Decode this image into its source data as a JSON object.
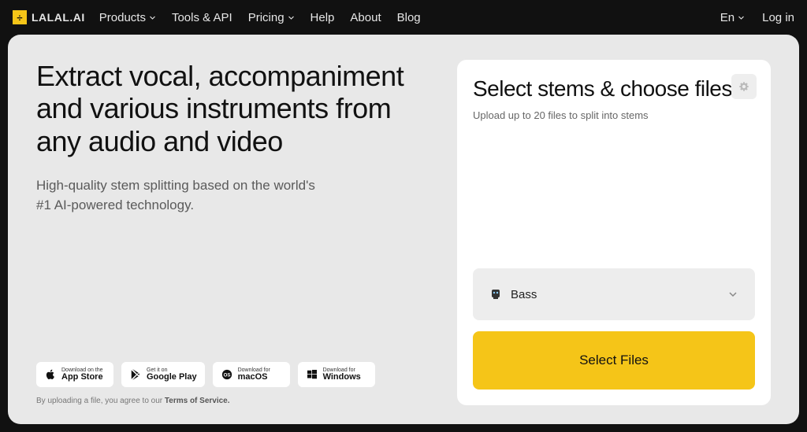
{
  "brand": {
    "name": "LALAL.AI"
  },
  "nav": {
    "products": "Products",
    "tools": "Tools & API",
    "pricing": "Pricing",
    "help": "Help",
    "about": "About",
    "blog": "Blog"
  },
  "topright": {
    "lang": "En",
    "login": "Log in"
  },
  "hero": {
    "title": "Extract vocal, accompaniment and various instruments from any audio and video",
    "subtitle": "High-quality stem splitting based on the world's #1 AI-powered technology."
  },
  "stores": {
    "appstore": {
      "top": "Download on the",
      "bottom": "App Store"
    },
    "google": {
      "top": "Get it on",
      "bottom": "Google Play"
    },
    "macos": {
      "top": "Download for",
      "bottom": "macOS"
    },
    "windows": {
      "top": "Download for",
      "bottom": "Windows"
    }
  },
  "terms": {
    "prefix": "By uploading a file, you agree to our ",
    "link": "Terms of Service."
  },
  "panel": {
    "title": "Select stems & choose files",
    "subtitle": "Upload up to 20 files to split into stems",
    "stem_selected": "Bass",
    "button": "Select Files"
  },
  "colors": {
    "accent": "#f5c518",
    "bg_dark": "#111111",
    "bg_panel": "#e8e8e8"
  }
}
